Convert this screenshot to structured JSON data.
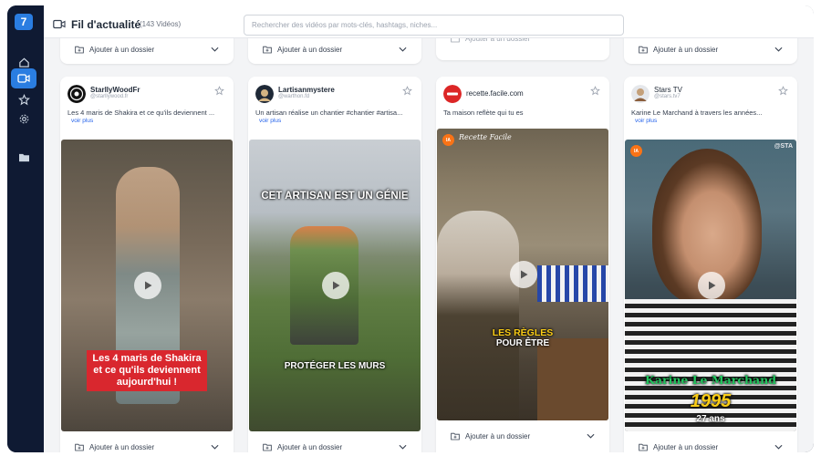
{
  "sidebar": {
    "logo": "7",
    "items": [
      {
        "icon": "home-icon"
      },
      {
        "icon": "video-icon",
        "active": true
      },
      {
        "icon": "star-icon"
      },
      {
        "icon": "gear-icon"
      },
      {
        "icon": "folder-icon"
      }
    ]
  },
  "header": {
    "title": "Fil d'actualité",
    "count": "(143 Vidéos)",
    "search_placeholder": "Rechercher des vidéos par mots-clés, hashtags, niches..."
  },
  "folder_label": "Ajouter à un dossier",
  "cards": [
    {
      "username": "StarllyWoodFr",
      "handle": "@starllywood.fr",
      "description": "Les 4 maris de Shakira et ce qu'ils deviennent ...",
      "more": "voir plus",
      "overlay_lines": [
        "Les 4 maris de Shakira",
        "et ce qu'ils deviennent",
        "aujourd'hui !"
      ],
      "badge": ""
    },
    {
      "username": "Lartisanmystere",
      "handle": "@warthon.fd",
      "description": "Un artisan réalise un chantier #chantier #artisa...",
      "more": "voir plus",
      "overlay_top": "CET ARTISAN EST UN GÉNIE",
      "overlay_bottom": "PROTÉGER LES MURS",
      "badge": ""
    },
    {
      "username": "recette.facile.com",
      "handle": "",
      "description": "Ta maison reflète qui tu es",
      "more": "",
      "watermark": "Recette Facile",
      "overlay_lines": [
        "LES RÈGLES",
        "POUR ÊTRE"
      ],
      "badge": "IA"
    },
    {
      "username": "Stars TV",
      "handle": "@stars.tv7",
      "description": "Karine Le Marchand à travers les années...",
      "more": "voir plus",
      "watermark": "@STA",
      "overlay_name": "Karine Le Marchand",
      "overlay_year": "1995",
      "overlay_age": "27 ans",
      "badge": "IA"
    }
  ]
}
